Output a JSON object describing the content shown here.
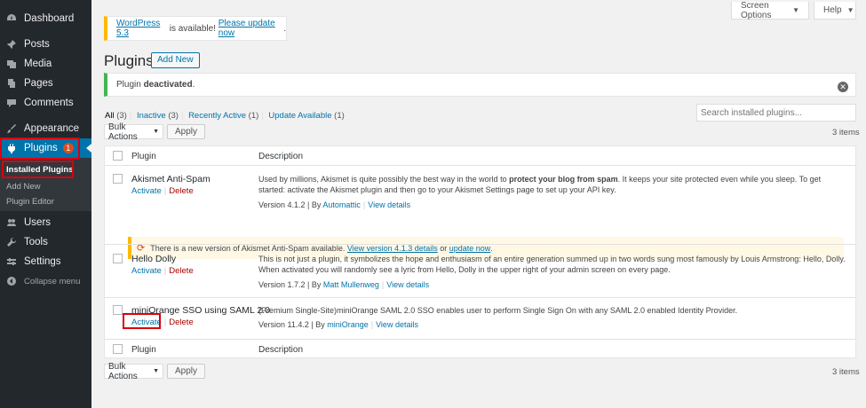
{
  "sidebar": {
    "items": [
      {
        "label": "Dashboard",
        "icon": "dashboard-icon"
      },
      {
        "label": "Posts",
        "icon": "pin-icon"
      },
      {
        "label": "Media",
        "icon": "media-icon"
      },
      {
        "label": "Pages",
        "icon": "page-icon"
      },
      {
        "label": "Comments",
        "icon": "comment-icon"
      },
      {
        "label": "Appearance",
        "icon": "paintbrush-icon"
      },
      {
        "label": "Plugins",
        "icon": "plugin-icon",
        "badge": "1"
      },
      {
        "label": "Users",
        "icon": "users-icon"
      },
      {
        "label": "Tools",
        "icon": "wrench-icon"
      },
      {
        "label": "Settings",
        "icon": "settings-icon"
      },
      {
        "label": "Collapse menu",
        "icon": "collapse-icon"
      }
    ],
    "submenu": [
      "Installed Plugins",
      "Add New",
      "Plugin Editor"
    ]
  },
  "screen_options": "Screen Options",
  "help": "Help",
  "update_notice": {
    "link1": "WordPress 5.3",
    "text": " is available! ",
    "link2": "Please update now",
    "end": "."
  },
  "page_title": "Plugins",
  "add_new": "Add New",
  "deactivated_notice": {
    "prefix": "Plugin ",
    "bold": "deactivated",
    "end": "."
  },
  "filters": [
    {
      "label": "All",
      "count": "(3)"
    },
    {
      "label": "Inactive",
      "count": "(3)"
    },
    {
      "label": "Recently Active",
      "count": "(1)"
    },
    {
      "label": "Update Available",
      "count": "(1)"
    }
  ],
  "search": {
    "placeholder": "Search installed plugins..."
  },
  "bulk_actions": "Bulk Actions",
  "apply": "Apply",
  "items_count": "3 items",
  "table": {
    "col_plugin": "Plugin",
    "col_description": "Description",
    "activate": "Activate",
    "delete": "Delete",
    "rows": [
      {
        "name": "Akismet Anti-Spam",
        "desc_pre": "Used by millions, Akismet is quite possibly the best way in the world to ",
        "desc_bold": "protect your blog from spam",
        "desc_post": ". It keeps your site protected even while you sleep. To get started: activate the Akismet plugin and then go to your Akismet Settings page to set up your API key.",
        "version": "Version 4.1.2 | By ",
        "author": "Automattic",
        "details": "View details"
      },
      {
        "name": "Hello Dolly",
        "desc": "This is not just a plugin, it symbolizes the hope and enthusiasm of an entire generation summed up in two words sung most famously by Louis Armstrong: Hello, Dolly. When activated you will randomly see a lyric from Hello, Dolly in the upper right of your admin screen on every page.",
        "version": "Version 1.7.2 | By ",
        "author": "Matt Mullenweg",
        "details": "View details"
      },
      {
        "name": "miniOrange SSO using SAML 2.0",
        "desc": "(Premium Single-Site)miniOrange SAML 2.0 SSO enables user to perform Single Sign On with any SAML 2.0 enabled Identity Provider.",
        "version": "Version 11.4.2 | By ",
        "author": "miniOrange",
        "details": "View details"
      }
    ],
    "akismet_update": {
      "pre": "There is a new version of Akismet Anti-Spam available. ",
      "link1": "View version 4.1.3 details",
      "mid": " or ",
      "link2": "update now",
      "end": "."
    }
  },
  "colors": {
    "accent": "#0073aa",
    "sidebar": "#23282d",
    "highlight": "#d9000d"
  }
}
